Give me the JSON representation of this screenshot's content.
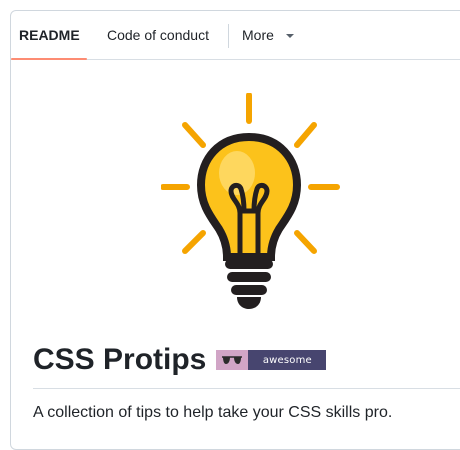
{
  "tabs": [
    {
      "label": "README",
      "active": true
    },
    {
      "label": "Code of conduct",
      "active": false
    },
    {
      "label": "More",
      "active": false
    }
  ],
  "readme": {
    "title": "CSS Protips",
    "badge_text": "awesome",
    "description": "A collection of tips to help take your CSS skills pro."
  },
  "colors": {
    "tab_underline": "#fd8c73",
    "bulb_yellow": "#fcc21b",
    "rays": "#f5a400",
    "badge_left": "#d1a5c6",
    "badge_right": "#47456f"
  },
  "icons": {
    "logo": "lightbulb-icon",
    "badge": "sunglasses-icon",
    "more": "caret-down-icon"
  }
}
